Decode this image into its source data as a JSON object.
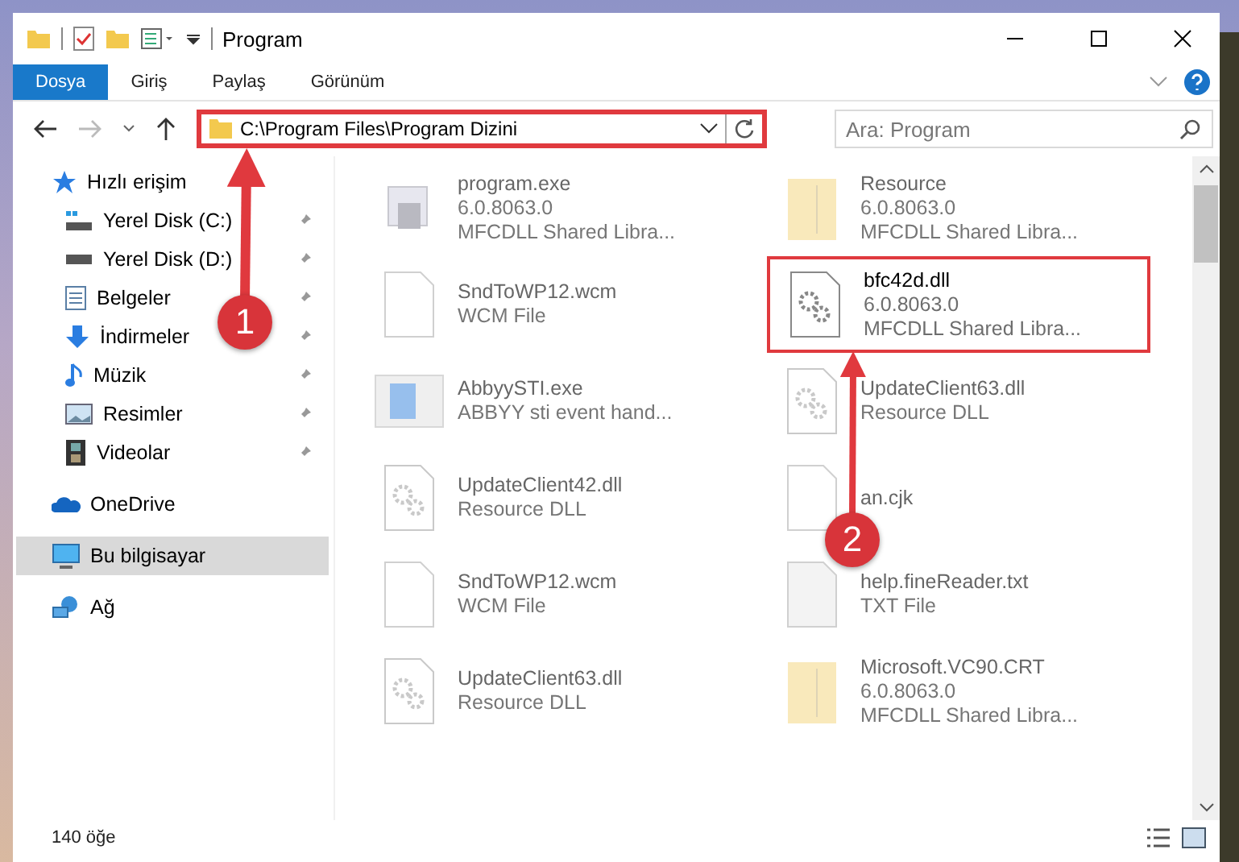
{
  "window": {
    "title": "Program"
  },
  "ribbon_tabs": [
    {
      "label": "Dosya",
      "selected": true
    },
    {
      "label": "Giriş",
      "selected": false
    },
    {
      "label": "Paylaş",
      "selected": false
    },
    {
      "label": "Görünüm",
      "selected": false
    }
  ],
  "address_bar": {
    "value": "C:\\Program Files\\Program Dizini",
    "highlighted": true
  },
  "search": {
    "placeholder": "Ara: Program"
  },
  "sidebar": {
    "items": [
      {
        "label": "Hızlı erişim",
        "kind": "star",
        "selected": false,
        "children": [
          {
            "label": "Yerel Disk (C:)",
            "kind": "system-drive",
            "pinned": true,
            "selected": false
          },
          {
            "label": "Yerel Disk (D:)",
            "kind": "drive",
            "pinned": true,
            "selected": false
          },
          {
            "label": "Belgeler",
            "kind": "document",
            "pinned": true,
            "selected": false
          },
          {
            "label": "İndirmeler",
            "kind": "download",
            "pinned": true,
            "selected": false
          },
          {
            "label": "Müzik",
            "kind": "music",
            "pinned": true,
            "selected": false
          },
          {
            "label": "Resimler",
            "kind": "picture",
            "pinned": true,
            "selected": false
          },
          {
            "label": "Videolar",
            "kind": "video",
            "pinned": true,
            "selected": false
          }
        ]
      },
      {
        "label": "OneDrive",
        "kind": "cloud",
        "selected": false
      },
      {
        "label": "Bu bilgisayar",
        "kind": "computer",
        "selected": true
      },
      {
        "label": "Ağ",
        "kind": "network",
        "selected": false
      }
    ]
  },
  "files": [
    {
      "name": "program.exe",
      "details": [
        "6.0.8063.0",
        "MFCDLL Shared Libra..."
      ],
      "kind": "exe",
      "highlighted": false,
      "dimmed": true
    },
    {
      "name": "Resource",
      "details": [
        "6.0.8063.0",
        "MFCDLL Shared Libra..."
      ],
      "kind": "folder",
      "highlighted": false,
      "dimmed": true
    },
    {
      "name": "SndToWP12.wcm",
      "details": [
        "WCM File"
      ],
      "kind": "file",
      "highlighted": false,
      "dimmed": true
    },
    {
      "name": "bfc42d.dll",
      "details": [
        "6.0.8063.0",
        "MFCDLL Shared Libra..."
      ],
      "kind": "gear",
      "highlighted": true,
      "dimmed": false
    },
    {
      "name": "AbbyySTI.exe",
      "details": [
        "ABBYY sti event hand..."
      ],
      "kind": "app",
      "highlighted": false,
      "dimmed": true
    },
    {
      "name": "UpdateClient63.dll",
      "details": [
        "Resource DLL"
      ],
      "kind": "dll",
      "highlighted": false,
      "dimmed": true
    },
    {
      "name": "UpdateClient42.dll",
      "details": [
        "Resource DLL"
      ],
      "kind": "dll",
      "highlighted": false,
      "dimmed": true
    },
    {
      "name": "an.cjk",
      "kind": "file",
      "highlighted": false,
      "dimmed": true
    },
    {
      "name": "SndToWP12.wcm",
      "details": [
        "WCM File"
      ],
      "kind": "file",
      "highlighted": false,
      "dimmed": true
    },
    {
      "name": "help.fineReader.txt",
      "details": [
        "TXT File"
      ],
      "kind": "text",
      "highlighted": false,
      "dimmed": true
    },
    {
      "name": "UpdateClient63.dll",
      "details": [
        "Resource DLL"
      ],
      "kind": "dll",
      "highlighted": false,
      "dimmed": true
    },
    {
      "name": "Microsoft.VC90.CRT",
      "details": [
        "6.0.8063.0",
        "MFCDLL Shared Libra..."
      ],
      "kind": "folder",
      "highlighted": false,
      "dimmed": true
    }
  ],
  "status_bar": {
    "count": "140 öğe"
  },
  "annotations": [
    {
      "number": "1"
    },
    {
      "number": "2"
    }
  ]
}
